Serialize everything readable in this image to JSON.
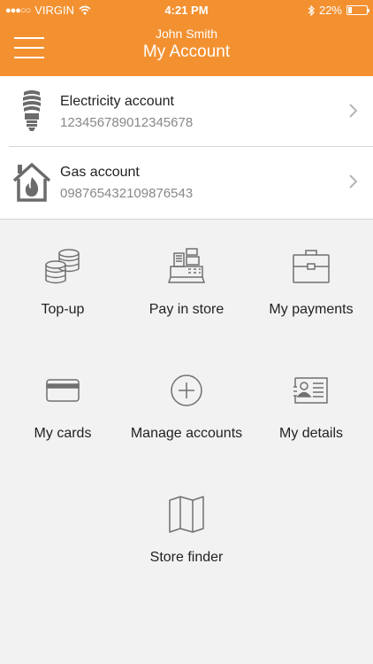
{
  "status_bar": {
    "carrier": "VIRGIN",
    "time": "4:21 PM",
    "battery": "22%",
    "battery_level": 0.22
  },
  "nav": {
    "user_name": "John Smith",
    "title": "My Account"
  },
  "accounts": [
    {
      "name": "Electricity account",
      "number": "123456789012345678",
      "icon": "lightbulb-icon"
    },
    {
      "name": "Gas account",
      "number": "098765432109876543",
      "icon": "gas-house-icon"
    }
  ],
  "actions": [
    {
      "label": "Top-up",
      "icon": "coins-icon"
    },
    {
      "label": "Pay in store",
      "icon": "cash-register-icon"
    },
    {
      "label": "My payments",
      "icon": "briefcase-icon"
    },
    {
      "label": "My cards",
      "icon": "card-icon"
    },
    {
      "label": "Manage accounts",
      "icon": "plus-circle-icon"
    },
    {
      "label": "My details",
      "icon": "id-card-icon"
    },
    {
      "label": "Store finder",
      "icon": "map-icon"
    }
  ],
  "colors": {
    "brand": "#f39131",
    "icon_gray": "#707070"
  }
}
